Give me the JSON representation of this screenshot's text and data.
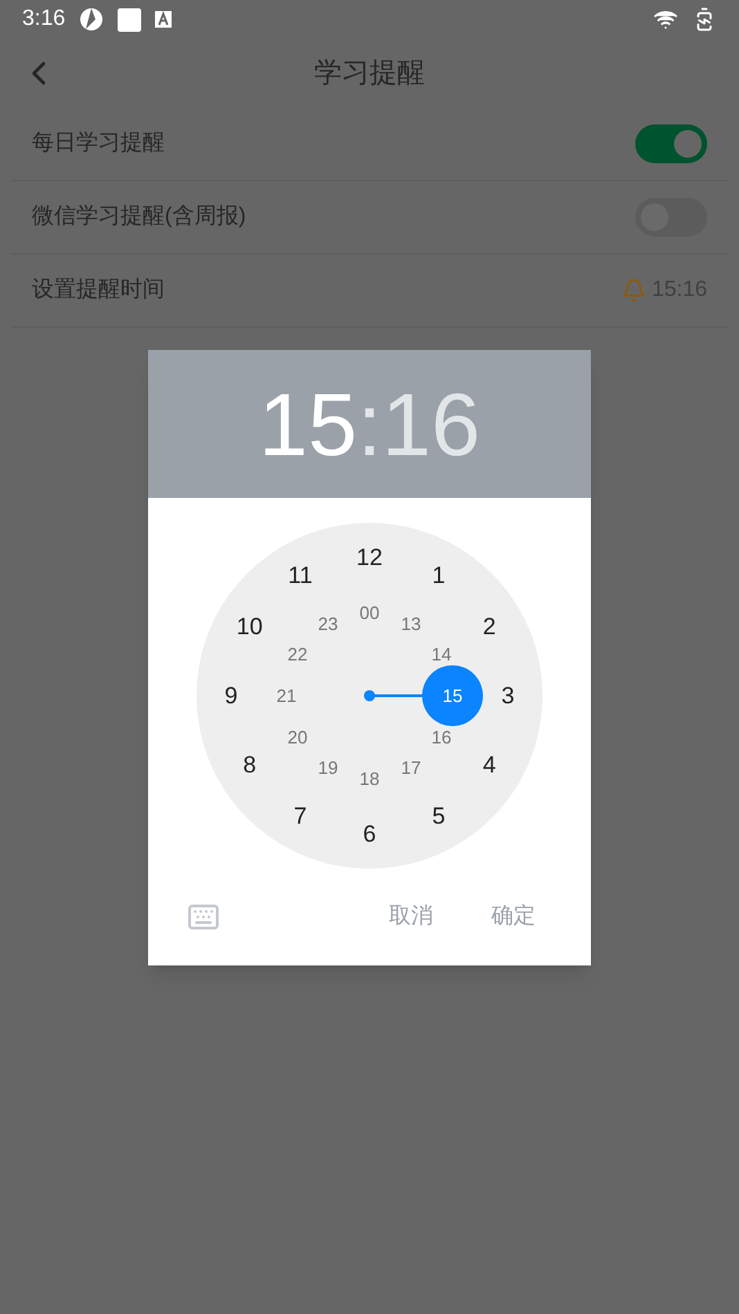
{
  "status_bar": {
    "time": "3:16"
  },
  "header": {
    "title": "学习提醒"
  },
  "settings": [
    {
      "kind": "toggle",
      "label": "每日学习提醒",
      "on": true
    },
    {
      "kind": "toggle",
      "label": "微信学习提醒(含周报)",
      "on": false
    },
    {
      "kind": "time",
      "label": "设置提醒时间",
      "value": "15:16"
    }
  ],
  "dialog": {
    "hour": "15",
    "separator": ":",
    "minute": "16",
    "hour_selected": true,
    "dial": {
      "outer": [
        {
          "label": "12",
          "selected": false
        },
        {
          "label": "1",
          "selected": false
        },
        {
          "label": "2",
          "selected": false
        },
        {
          "label": "3",
          "selected": false
        },
        {
          "label": "4",
          "selected": false
        },
        {
          "label": "5",
          "selected": false
        },
        {
          "label": "6",
          "selected": false
        },
        {
          "label": "7",
          "selected": false
        },
        {
          "label": "8",
          "selected": false
        },
        {
          "label": "9",
          "selected": false
        },
        {
          "label": "10",
          "selected": false
        },
        {
          "label": "11",
          "selected": false
        }
      ],
      "inner": [
        {
          "label": "00",
          "selected": false
        },
        {
          "label": "13",
          "selected": false
        },
        {
          "label": "14",
          "selected": false
        },
        {
          "label": "15",
          "selected": true
        },
        {
          "label": "16",
          "selected": false
        },
        {
          "label": "17",
          "selected": false
        },
        {
          "label": "18",
          "selected": false
        },
        {
          "label": "19",
          "selected": false
        },
        {
          "label": "20",
          "selected": false
        },
        {
          "label": "21",
          "selected": false
        },
        {
          "label": "22",
          "selected": false
        },
        {
          "label": "23",
          "selected": false
        }
      ]
    },
    "buttons": [
      "取消",
      "确定"
    ]
  }
}
